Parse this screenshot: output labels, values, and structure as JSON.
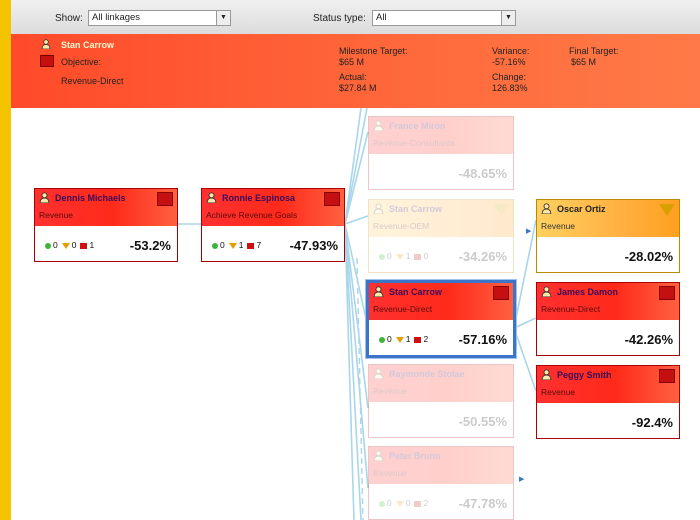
{
  "toolbar": {
    "show_label": "Show:",
    "show_value": "All linkages",
    "status_label": "Status type:",
    "status_value": "All"
  },
  "summary": {
    "owner": "Stan Carrow",
    "objective_label": "Objective:",
    "objective_value": "Revenue-Direct",
    "milestone_label": "Milestone Target:",
    "milestone_value": "$65 M",
    "actual_label": "Actual:",
    "actual_value": "$27.84 M",
    "variance_label": "Variance:",
    "variance_value": "-57.16%",
    "change_label": "Change:",
    "change_value": "126.83%",
    "final_label": "Final Target:",
    "final_value": "$65 M"
  },
  "colors": {
    "accent_red": "#ff3030",
    "selected_border": "#3b74c8",
    "warning_yellow": "#ffb040"
  },
  "cards": {
    "dennis": {
      "name": "Dennis Michaels",
      "objective": "Revenue",
      "green": "0",
      "yellow": "0",
      "red": "1",
      "value": "-53.2%"
    },
    "ronnie": {
      "name": "Ronnie Espinosa",
      "objective": "Achieve Revenue Goals",
      "green": "0",
      "yellow": "1",
      "red": "7",
      "value": "-47.93%"
    },
    "france": {
      "name": "France Miron",
      "objective": "Revenue-Consultants",
      "value": "-48.65%"
    },
    "stan_oem": {
      "name": "Stan Carrow",
      "objective": "Revenue-OEM",
      "green": "0",
      "yellow": "1",
      "red": "0",
      "value": "-34.26%"
    },
    "stan_direct": {
      "name": "Stan Carrow",
      "objective": "Revenue-Direct",
      "green": "0",
      "yellow": "1",
      "red": "2",
      "value": "-57.16%"
    },
    "raymond": {
      "name": "Raymonde Stolae",
      "objective": "Revenue",
      "value": "-50.55%"
    },
    "peter": {
      "name": "Peter Brunn",
      "objective": "Revenue",
      "green": "0",
      "yellow": "0",
      "red": "2",
      "value": "-47.78%"
    },
    "oscar": {
      "name": "Oscar Ortiz",
      "objective": "Revenue",
      "value": "-28.02%"
    },
    "james": {
      "name": "James Damon",
      "objective": "Revenue-Direct",
      "value": "-42.26%"
    },
    "peggy": {
      "name": "Peggy Smith",
      "objective": "Revenue",
      "value": "-92.4%"
    }
  }
}
